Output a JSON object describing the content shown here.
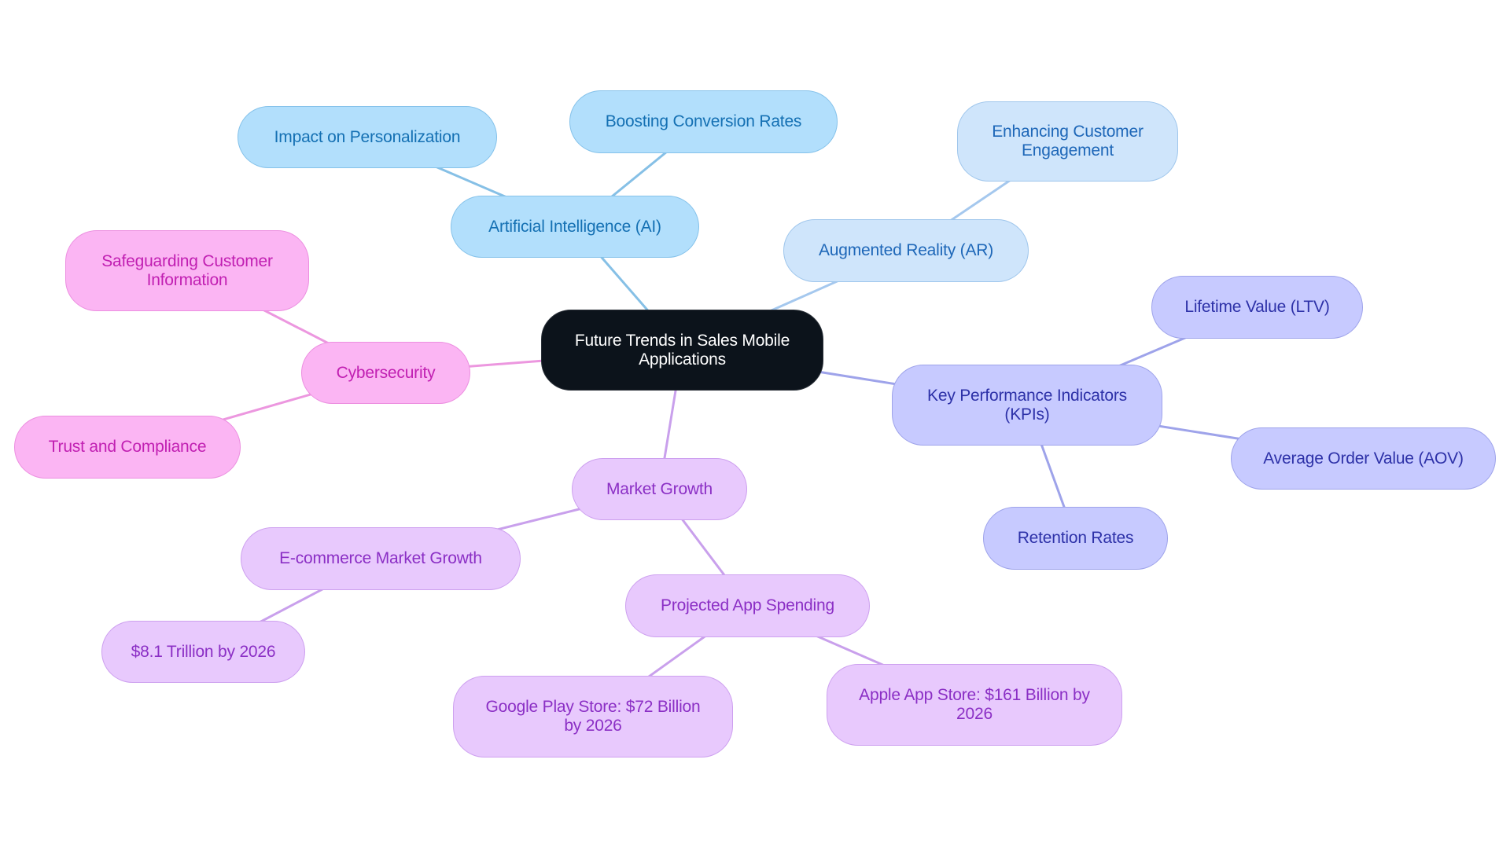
{
  "title": "Future Trends in Sales Mobile Applications",
  "colors": {
    "root": "#0c131b",
    "ai_branch": "#b2dffc",
    "ar_branch": "#cfe5fb",
    "cybersecurity_branch": "#fbb5f3",
    "kpi_branch": "#c7caff",
    "market_growth_branch": "#e8c9fd"
  },
  "nodes": {
    "root": "Future Trends in Sales Mobile\nApplications",
    "ai": "Artificial Intelligence (AI)",
    "ai_personalization": "Impact on Personalization",
    "ai_conversion": "Boosting Conversion Rates",
    "ar": "Augmented Reality (AR)",
    "ar_engagement": "Enhancing Customer\nEngagement",
    "cyber": "Cybersecurity",
    "cyber_safeguard": "Safeguarding Customer\nInformation",
    "cyber_trust": "Trust and Compliance",
    "kpi": "Key Performance Indicators\n(KPIs)",
    "kpi_ltv": "Lifetime Value (LTV)",
    "kpi_aov": "Average Order Value (AOV)",
    "kpi_retention": "Retention Rates",
    "market": "Market Growth",
    "market_ecom": "E-commerce Market Growth",
    "market_ecom_value": "$8.1 Trillion by 2026",
    "market_app": "Projected App Spending",
    "market_app_google": "Google Play Store: $72 Billion\nby 2026",
    "market_app_apple": "Apple App Store: $161 Billion by\n2026"
  },
  "edges": [
    [
      "root",
      "ai"
    ],
    [
      "ai",
      "ai_personalization"
    ],
    [
      "ai",
      "ai_conversion"
    ],
    [
      "root",
      "ar"
    ],
    [
      "ar",
      "ar_engagement"
    ],
    [
      "root",
      "cyber"
    ],
    [
      "cyber",
      "cyber_safeguard"
    ],
    [
      "cyber",
      "cyber_trust"
    ],
    [
      "root",
      "kpi"
    ],
    [
      "kpi",
      "kpi_ltv"
    ],
    [
      "kpi",
      "kpi_aov"
    ],
    [
      "kpi",
      "kpi_retention"
    ],
    [
      "root",
      "market"
    ],
    [
      "market",
      "market_ecom"
    ],
    [
      "market_ecom",
      "market_ecom_value"
    ],
    [
      "market",
      "market_app"
    ],
    [
      "market_app",
      "market_app_google"
    ],
    [
      "market_app",
      "market_app_apple"
    ]
  ]
}
